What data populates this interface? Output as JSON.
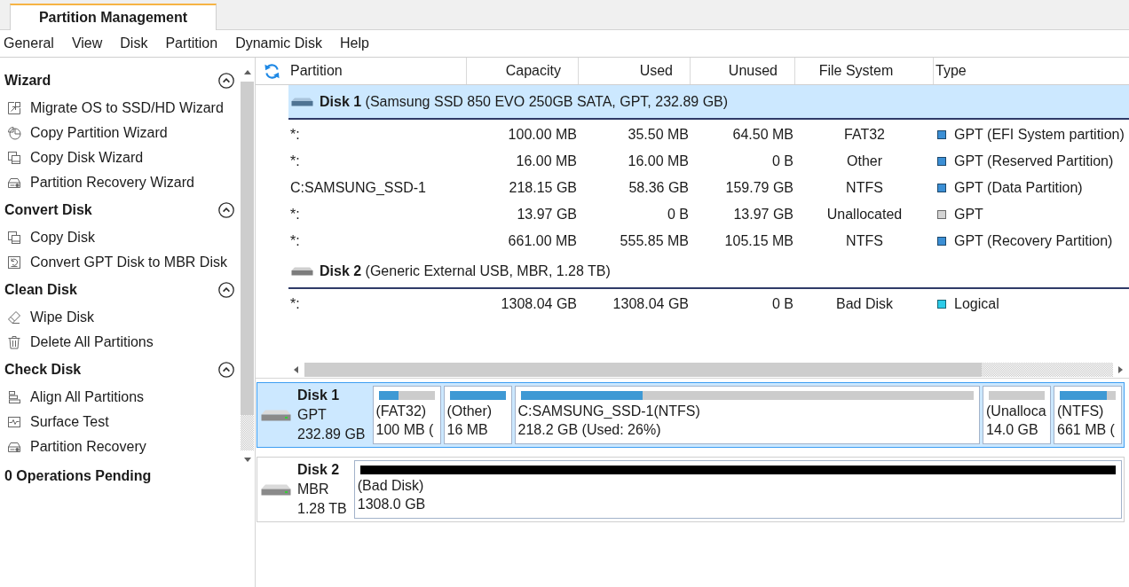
{
  "tabs": [
    {
      "label": "Partition Management",
      "selected": true
    }
  ],
  "menu": [
    "General",
    "View",
    "Disk",
    "Partition",
    "Dynamic Disk",
    "Help"
  ],
  "sidebar": {
    "sections": [
      {
        "title": "Wizard",
        "expanded": true,
        "items": [
          "Migrate OS to SSD/HD Wizard",
          "Copy Partition Wizard",
          "Copy Disk Wizard",
          "Partition Recovery Wizard"
        ]
      },
      {
        "title": "Convert Disk",
        "expanded": true,
        "items": [
          "Copy Disk",
          "Convert GPT Disk to MBR Disk"
        ]
      },
      {
        "title": "Clean Disk",
        "expanded": true,
        "items": [
          "Wipe Disk",
          "Delete All Partitions"
        ]
      },
      {
        "title": "Check Disk",
        "expanded": true,
        "items": [
          "Align All Partitions",
          "Surface Test",
          "Partition Recovery"
        ]
      }
    ],
    "pending": "0 Operations Pending"
  },
  "table": {
    "columns": [
      "Partition",
      "Capacity",
      "Used",
      "Unused",
      "File System",
      "Type"
    ],
    "disks": [
      {
        "name": "Disk 1",
        "details": "(Samsung SSD 850 EVO 250GB SATA, GPT, 232.89 GB)",
        "selected": true,
        "rows": [
          {
            "partition": "*:",
            "capacity": "100.00 MB",
            "used": "35.50 MB",
            "unused": "64.50 MB",
            "file_system": "FAT32",
            "type": "GPT (EFI System partition)",
            "color": "#3b8fd5"
          },
          {
            "partition": "*:",
            "capacity": "16.00 MB",
            "used": "16.00 MB",
            "unused": "0 B",
            "file_system": "Other",
            "type": "GPT (Reserved Partition)",
            "color": "#3b8fd5"
          },
          {
            "partition": "C:SAMSUNG_SSD-1",
            "capacity": "218.15 GB",
            "used": "58.36 GB",
            "unused": "159.79 GB",
            "file_system": "NTFS",
            "type": "GPT (Data Partition)",
            "color": "#3b8fd5"
          },
          {
            "partition": "*:",
            "capacity": "13.97 GB",
            "used": "0 B",
            "unused": "13.97 GB",
            "file_system": "Unallocated",
            "type": "GPT",
            "color": "#d4d4d4"
          },
          {
            "partition": "*:",
            "capacity": "661.00 MB",
            "used": "555.85 MB",
            "unused": "105.15 MB",
            "file_system": "NTFS",
            "type": "GPT (Recovery Partition)",
            "color": "#3b8fd5"
          }
        ]
      },
      {
        "name": "Disk 2",
        "details": "(Generic External USB, MBR, 1.28 TB)",
        "selected": false,
        "rows": [
          {
            "partition": "*:",
            "capacity": "1308.04 GB",
            "used": "1308.04 GB",
            "unused": "0 B",
            "file_system": "Bad Disk",
            "type": "Logical",
            "color": "#2ccbe8"
          }
        ]
      }
    ]
  },
  "disk_map": {
    "disks": [
      {
        "name": "Disk 1",
        "style": "GPT",
        "size": "232.89 GB",
        "selected": true,
        "partitions": [
          {
            "label": "(FAT32)",
            "size": "100 MB (",
            "level": 0.35,
            "color": "#3e99d4"
          },
          {
            "label": "(Other)",
            "size": "16 MB",
            "level": 1,
            "color": "#3e99d4"
          },
          {
            "label": "C:SAMSUNG_SSD-1(NTFS)",
            "size": "218.2 GB (Used: 26%)",
            "level": 0.27,
            "color": "#3e99d4"
          },
          {
            "label": "(Unalloca",
            "size": "14.0 GB"
          },
          {
            "label": "(NTFS)",
            "size": "661 MB (",
            "level": 0.84,
            "color": "#3e99d4"
          }
        ]
      },
      {
        "name": "Disk 2",
        "style": "MBR",
        "size": "1.28 TB",
        "selected": false,
        "partitions": [
          {
            "label": "(Bad Disk)",
            "size": "1308.0 GB",
            "level": 1,
            "color": "#000000"
          }
        ]
      }
    ]
  }
}
